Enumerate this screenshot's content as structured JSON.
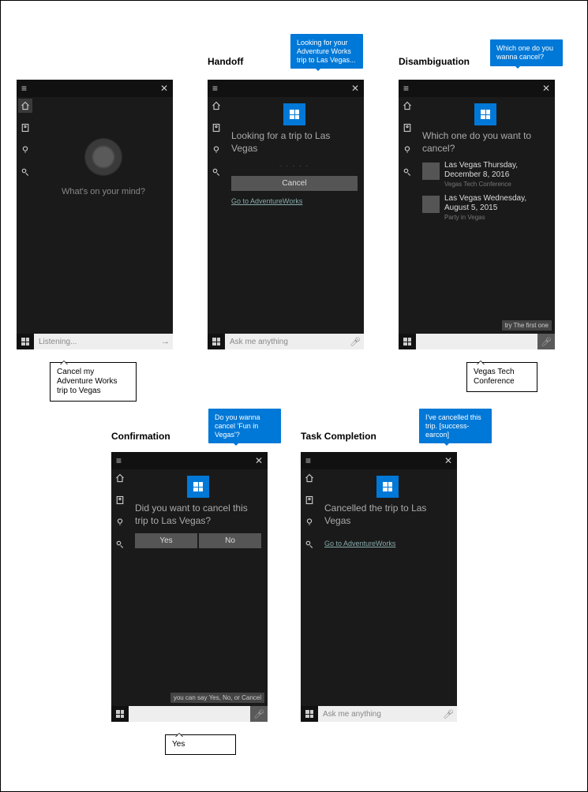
{
  "titles": {
    "handoff": "Handoff",
    "disambiguation": "Disambiguation",
    "confirmation": "Confirmation",
    "completion": "Task Completion"
  },
  "speech": {
    "handoff": "Looking for your Adventure Works trip to Las Vegas...",
    "disambiguation": "Which one do you wanna cancel?",
    "confirmation": "Do you wanna cancel 'Fun in Vegas'?",
    "completion": "I've cancelled this trip. [success-earcon]"
  },
  "callouts": {
    "initial": "Cancel my Adventure Works trip to Vegas",
    "disambiguation": "Vegas Tech Conference",
    "confirmation": "Yes"
  },
  "panel1": {
    "prompt": "What's on your mind?",
    "search": "Listening..."
  },
  "panel2": {
    "heading": "Looking for a trip to Las Vegas",
    "dots": ". . . . .",
    "cancel": "Cancel",
    "link": "Go to AdventureWorks",
    "search": "Ask me anything"
  },
  "panel3": {
    "heading": "Which one do you want to cancel?",
    "items": [
      {
        "title": "Las Vegas Thursday, December 8, 2016",
        "sub": "Vegas Tech Conference"
      },
      {
        "title": "Las Vegas Wednesday, August 5, 2015",
        "sub": "Party in Vegas"
      }
    ],
    "hint": "try The first one",
    "search": ""
  },
  "panel4": {
    "heading": "Did you want to cancel this trip to Las Vegas?",
    "yes": "Yes",
    "no": "No",
    "hint": "you can say Yes, No, or Cancel",
    "search": ""
  },
  "panel5": {
    "heading": "Cancelled the trip to Las Vegas",
    "link": "Go to AdventureWorks",
    "search": "Ask me anything"
  }
}
